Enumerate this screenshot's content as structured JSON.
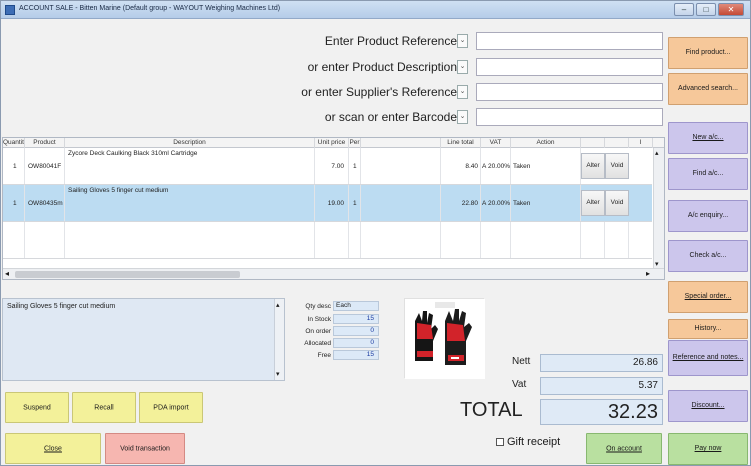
{
  "window": {
    "title": "ACCOUNT SALE - Bitten Marine (Default group - WAYOUT Weighing Machines Ltd)",
    "controls": [
      "–",
      "□",
      "✕"
    ]
  },
  "search": {
    "product_reference_label": "Enter Product Reference",
    "product_description_label": "or enter Product Description",
    "supplier_reference_label": "or enter Supplier's Reference",
    "barcode_label": "or scan or enter Barcode",
    "product_reference_value": "",
    "product_description_value": "",
    "supplier_reference_value": "",
    "barcode_value": "",
    "dropdown_glyph": "⌄"
  },
  "grid": {
    "columns": [
      "Quantity",
      "Product",
      "Description",
      "Unit price",
      "Per",
      "",
      "Line total",
      "VAT",
      "Action",
      "",
      "",
      "I"
    ],
    "rows": [
      {
        "quantity": "1",
        "product": "OW80041F",
        "description": "Zycore Deck Caulking Black 310ml Cartridge",
        "unit_price": "7.00",
        "per": "1",
        "line_total": "8.40",
        "vat_code": "A",
        "vat_rate": "20.00%",
        "action": "Taken",
        "alter": "Alter",
        "void": "Void"
      },
      {
        "quantity": "1",
        "product": "OW80435m",
        "description": "Sailing Gloves 5 finger cut medium",
        "unit_price": "19.00",
        "per": "1",
        "line_total": "22.80",
        "vat_code": "A",
        "vat_rate": "20.00%",
        "action": "Taken",
        "alter": "Alter",
        "void": "Void"
      }
    ],
    "scroll_left": "◂",
    "scroll_right": "▸",
    "scroll_up": "▴",
    "scroll_down": "▾"
  },
  "detail": {
    "description": "Sailing Gloves 5 finger cut medium",
    "stock": [
      {
        "label": "Qty desc",
        "value": "Each"
      },
      {
        "label": "In Stock",
        "value": "15"
      },
      {
        "label": "On order",
        "value": "0"
      },
      {
        "label": "Allocated",
        "value": "0"
      },
      {
        "label": "Free",
        "value": "15"
      }
    ],
    "product_image_icon": "sailing-gloves-image"
  },
  "totals": {
    "nett_label": "Nett",
    "nett_value": "26.86",
    "vat_label": "Vat",
    "vat_value": "5.37",
    "total_label": "TOTAL",
    "total_value": "32.23"
  },
  "bottom_buttons": {
    "suspend": "Suspend",
    "recall": "Recall",
    "pda_import": "PDA import",
    "close": "Close",
    "void_transaction": "Void transaction",
    "gift_receipt": "Gift receipt",
    "on_account": "On account",
    "pay_now": "Pay now"
  },
  "side_buttons": {
    "find_product": "Find product...",
    "advanced_search": "Advanced search...",
    "new_ac": "New a/c...",
    "find_ac": "Find a/c...",
    "ac_enquiry": "A/c enquiry...",
    "check_ac": "Check a/c...",
    "special_order": "Special order...",
    "history": "History...",
    "reference_notes": "Reference and notes...",
    "discount": "Discount..."
  },
  "colors": {
    "orange_button": "#f6c89a",
    "lavender_button": "#ccc6ec",
    "yellow_button": "#f3f19a",
    "pink_button": "#f6b6b0",
    "green_button": "#b9e0a0",
    "selected_row": "#bcdcf2"
  }
}
